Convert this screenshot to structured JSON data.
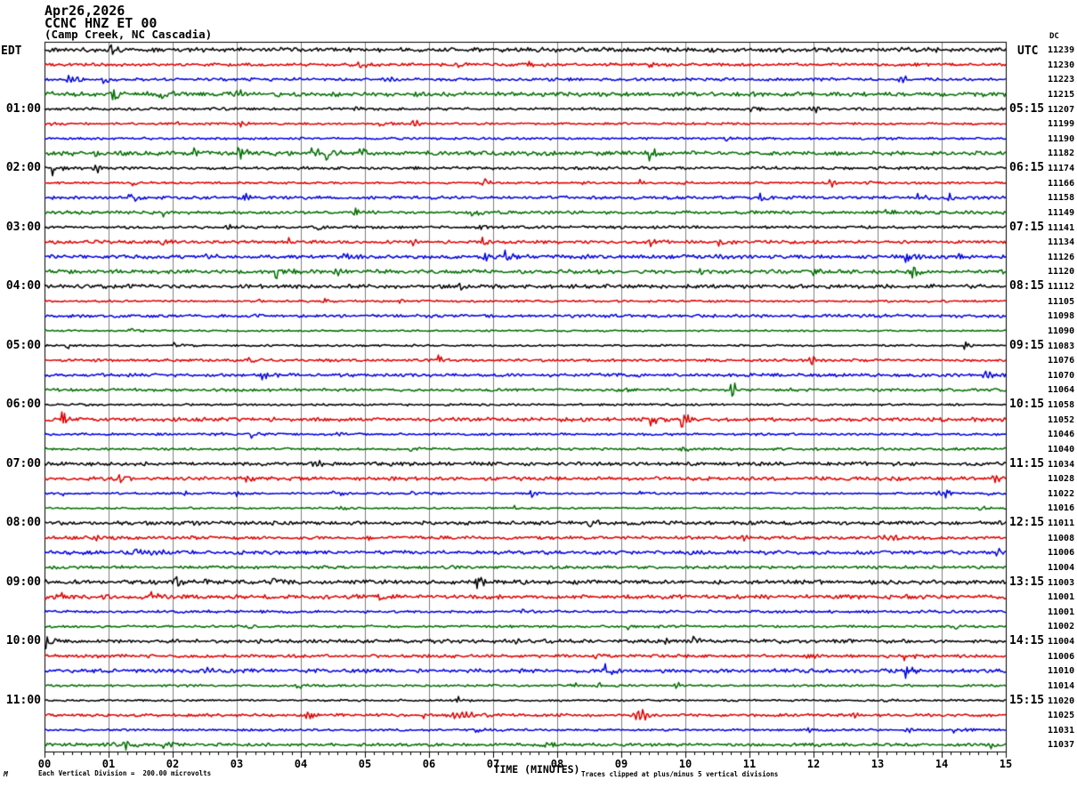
{
  "title": {
    "date": "Apr26,2026",
    "station": "CCNC HNZ ET 00",
    "location": "(Camp Creek, NC Cascadia)"
  },
  "axes": {
    "left_label": "EDT",
    "right_label": "UTC",
    "right_sub_label": "DC",
    "x_label": "TIME (MINUTES)"
  },
  "footer": {
    "left_note": "Each Vertical Division =  200.00 microvolts",
    "right_note": "Traces clipped at plus/minus 5 vertical divisions",
    "corner_mark": "M"
  },
  "chart_data": {
    "type": "line",
    "subtype": "helicorder-seismogram",
    "title": "Apr26,2026 CCNC HNZ ET 00 (Camp Creek, NC Cascadia)",
    "xlabel": "TIME (MINUTES)",
    "xlim": [
      0,
      15
    ],
    "x_ticks": [
      "00",
      "01",
      "02",
      "03",
      "04",
      "05",
      "06",
      "07",
      "08",
      "09",
      "10",
      "11",
      "12",
      "13",
      "14",
      "15"
    ],
    "minutes_per_row": 15,
    "grid": true,
    "grid_color": "#808080",
    "frame_color": "#000000",
    "seed": 20260426,
    "color_cycle": [
      "black",
      "red",
      "blue",
      "green"
    ],
    "colors": {
      "black": "#000000",
      "red": "#e00000",
      "blue": "#0000e0",
      "green": "#006e00"
    },
    "hour_labels": [
      {
        "row": 4,
        "edt": "01:00",
        "utc": "05:15"
      },
      {
        "row": 8,
        "edt": "02:00",
        "utc": "06:15"
      },
      {
        "row": 12,
        "edt": "03:00",
        "utc": "07:15"
      },
      {
        "row": 16,
        "edt": "04:00",
        "utc": "08:15"
      },
      {
        "row": 20,
        "edt": "05:00",
        "utc": "09:15"
      },
      {
        "row": 24,
        "edt": "06:00",
        "utc": "10:15"
      },
      {
        "row": 28,
        "edt": "07:00",
        "utc": "11:15"
      },
      {
        "row": 32,
        "edt": "08:00",
        "utc": "12:15"
      },
      {
        "row": 36,
        "edt": "09:00",
        "utc": "13:15"
      },
      {
        "row": 40,
        "edt": "10:00",
        "utc": "14:15"
      },
      {
        "row": 44,
        "edt": "11:00",
        "utc": "15:15"
      }
    ],
    "rows": [
      {
        "count": "11239"
      },
      {
        "count": "11230"
      },
      {
        "count": "11223"
      },
      {
        "count": "11215"
      },
      {
        "count": "11207"
      },
      {
        "count": "11199"
      },
      {
        "count": "11190"
      },
      {
        "count": "11182"
      },
      {
        "count": "11174"
      },
      {
        "count": "11166"
      },
      {
        "count": "11158"
      },
      {
        "count": "11149"
      },
      {
        "count": "11141"
      },
      {
        "count": "11134"
      },
      {
        "count": "11126"
      },
      {
        "count": "11120"
      },
      {
        "count": "11112"
      },
      {
        "count": "11105"
      },
      {
        "count": "11098"
      },
      {
        "count": "11090"
      },
      {
        "count": "11083"
      },
      {
        "count": "11076"
      },
      {
        "count": "11070"
      },
      {
        "count": "11064"
      },
      {
        "count": "11058"
      },
      {
        "count": "11052"
      },
      {
        "count": "11046"
      },
      {
        "count": "11040"
      },
      {
        "count": "11034"
      },
      {
        "count": "11028"
      },
      {
        "count": "11022"
      },
      {
        "count": "11016"
      },
      {
        "count": "11011"
      },
      {
        "count": "11008"
      },
      {
        "count": "11006"
      },
      {
        "count": "11004"
      },
      {
        "count": "11003"
      },
      {
        "count": "11001"
      },
      {
        "count": "11001"
      },
      {
        "count": "11002"
      },
      {
        "count": "11004"
      },
      {
        "count": "11006"
      },
      {
        "count": "11010"
      },
      {
        "count": "11014"
      },
      {
        "count": "11020"
      },
      {
        "count": "11025"
      },
      {
        "count": "11031"
      },
      {
        "count": "11037"
      }
    ],
    "events": [
      {
        "row": 2,
        "min": 5.39,
        "amp": 3
      },
      {
        "row": 2,
        "min": 13.4,
        "amp": 4
      },
      {
        "row": 3,
        "min": 3.03,
        "amp": 5
      },
      {
        "row": 4,
        "min": 12.04,
        "amp": 4
      },
      {
        "row": 5,
        "min": 5.78,
        "amp": 4
      },
      {
        "row": 7,
        "min": 0.8,
        "amp": 3
      },
      {
        "row": 8,
        "min": 0.83,
        "amp": 4
      },
      {
        "row": 9,
        "min": 12.29,
        "amp": 5
      },
      {
        "row": 12,
        "min": 2.86,
        "amp": 2.5
      },
      {
        "row": 13,
        "min": 5.75,
        "amp": 2.5
      },
      {
        "row": 14,
        "min": 8.44,
        "amp": 3
      },
      {
        "row": 14,
        "min": 10.51,
        "amp": 2.5
      },
      {
        "row": 14,
        "min": 13.61,
        "amp": 3
      },
      {
        "row": 15,
        "min": 4.58,
        "amp": 5
      },
      {
        "row": 21,
        "min": 11.97,
        "amp": 6
      },
      {
        "row": 22,
        "min": 14.72,
        "amp": 5
      },
      {
        "row": 23,
        "min": 10.74,
        "amp": 10,
        "w": 2.5
      },
      {
        "row": 26,
        "min": 4.6,
        "amp": 2.5
      },
      {
        "row": 28,
        "min": 4.26,
        "amp": 5
      },
      {
        "row": 29,
        "min": 14.83,
        "amp": 3.5
      },
      {
        "row": 30,
        "min": 13.99,
        "amp": 3
      },
      {
        "row": 33,
        "min": 0.81,
        "amp": 4
      },
      {
        "row": 33,
        "min": 10.92,
        "amp": 3
      },
      {
        "row": 34,
        "min": 1.75,
        "amp": 2.5,
        "w": 15
      },
      {
        "row": 40,
        "min": 7.36,
        "amp": 3
      },
      {
        "row": 42,
        "min": 2.58,
        "amp": 4
      },
      {
        "row": 43,
        "min": 9.86,
        "amp": 3
      },
      {
        "row": 45,
        "min": 6.55,
        "amp": 4,
        "w": 9
      },
      {
        "row": 45,
        "min": 9.3,
        "amp": 7,
        "w": 6
      },
      {
        "row": 45,
        "min": 12.65,
        "amp": 3
      },
      {
        "row": 46,
        "min": 13.5,
        "amp": 3
      }
    ]
  }
}
